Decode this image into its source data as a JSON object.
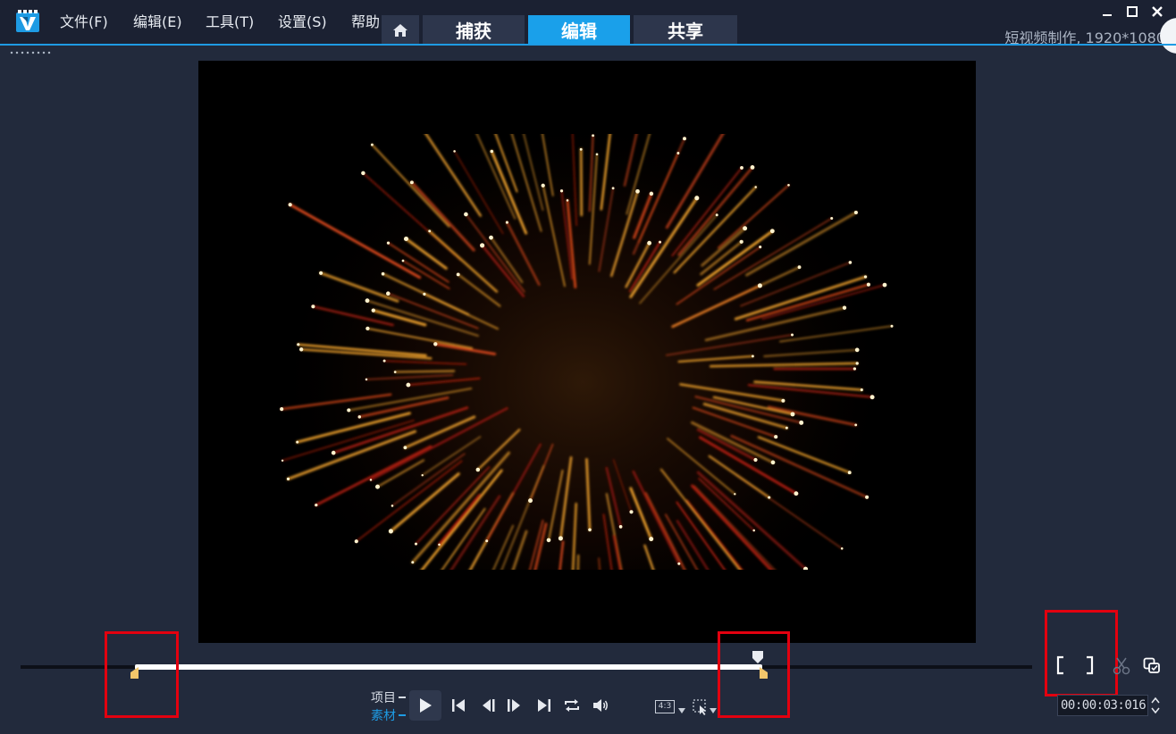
{
  "menu": {
    "file": "文件(F)",
    "edit": "编辑(E)",
    "tools": "工具(T)",
    "settings": "设置(S)",
    "help": "帮助"
  },
  "tabs": {
    "capture": "捕获",
    "edit": "编辑",
    "share": "共享",
    "active": "编辑"
  },
  "project_info": "短视频制作, 1920*1080",
  "playback": {
    "mode_project": "项目",
    "mode_clip": "素材",
    "aspect_ratio": "4:3",
    "timecode": "00:00:03:016",
    "selection_start": 0.113,
    "selection_end": 0.733,
    "playhead": 0.729
  },
  "colors": {
    "accent": "#1e9be4",
    "highlight": "#e3000f",
    "trim_marker": "#f2c66b"
  },
  "icons": {
    "home": "home-icon",
    "play": "play-icon",
    "prev": "skip-to-start-icon",
    "step_back": "step-back-icon",
    "step_forward": "step-forward-icon",
    "next": "skip-to-end-icon",
    "repeat": "repeat-icon",
    "volume": "volume-icon",
    "scissors": "scissors-icon",
    "copy": "copy-to-clipboard-icon"
  }
}
